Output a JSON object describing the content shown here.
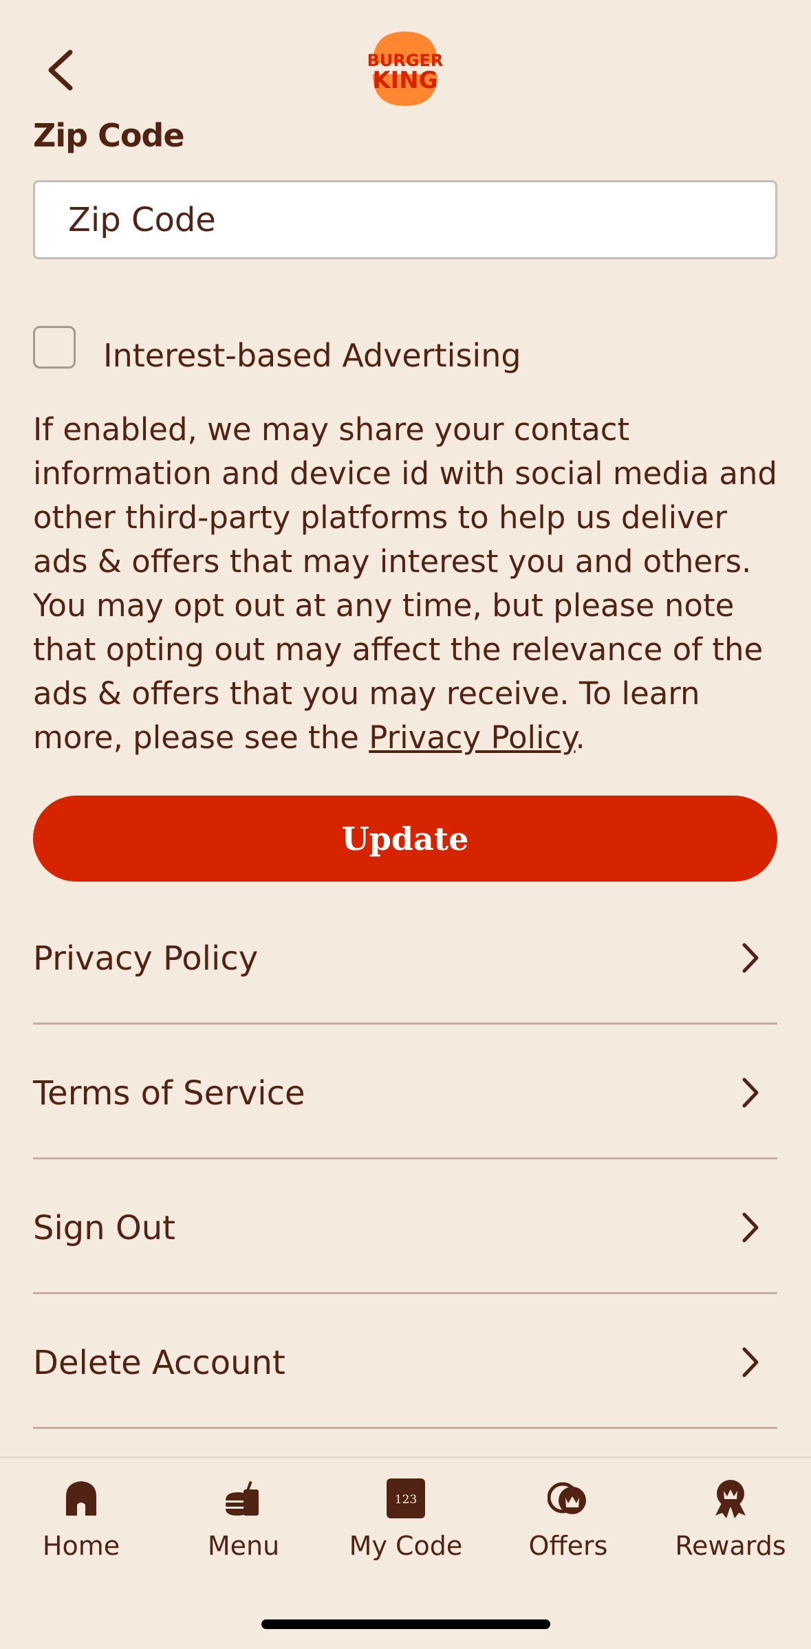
{
  "header": {
    "back_icon": "chevron-left-icon",
    "logo_text_top": "BURGER",
    "logo_text_bottom": "KING"
  },
  "zip": {
    "label": "Zip Code",
    "placeholder": "Zip Code",
    "value": ""
  },
  "advertising": {
    "checked": false,
    "label": "Interest-based Advertising",
    "description": "If enabled, we may share your contact information and device id with social media and other third-party platforms to help us deliver ads & offers that may interest you and others. You may opt out at any time, but please note that opting out may affect the relevance of the ads & offers that you may receive. To learn more, please see the",
    "link_text": "Privacy Policy",
    "link_suffix": "."
  },
  "update_button": "Update",
  "menu": [
    {
      "label": "Privacy Policy"
    },
    {
      "label": "Terms of Service"
    },
    {
      "label": "Sign Out"
    },
    {
      "label": "Delete Account"
    }
  ],
  "tabs": [
    {
      "label": "Home",
      "icon": "home-icon"
    },
    {
      "label": "Menu",
      "icon": "burger-drink-icon"
    },
    {
      "label": "My Code",
      "icon": "code-123-icon",
      "icon_text": "123"
    },
    {
      "label": "Offers",
      "icon": "offers-crown-icon"
    },
    {
      "label": "Rewards",
      "icon": "rewards-ribbon-icon"
    }
  ],
  "colors": {
    "background": "#f4eadd",
    "text": "#502314",
    "accent": "#d62300",
    "logo_bun": "#ff8732"
  }
}
